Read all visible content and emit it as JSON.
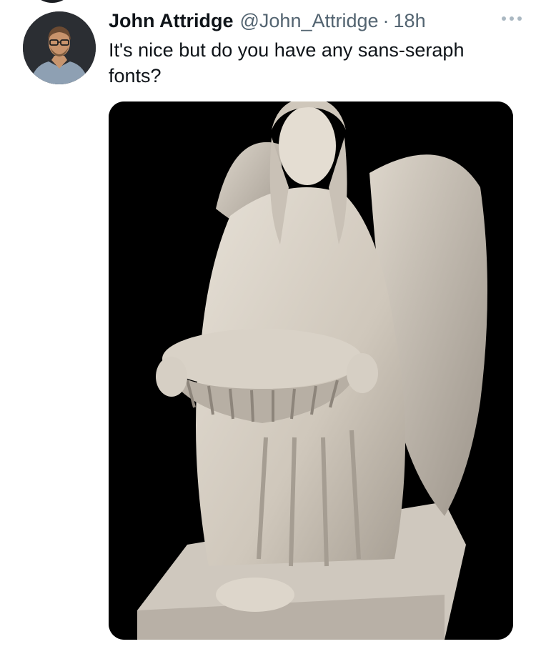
{
  "tweet": {
    "author_name": "John Attridge",
    "handle": "@John_Attridge",
    "separator": "·",
    "timestamp": "18h",
    "text_lines": [
      "It's nice but do you have any sans-seraph",
      "fonts?"
    ]
  },
  "icons": {
    "more": "more-horizontal-icon",
    "avatar": "avatar-photo",
    "media": "angel-statue-photo"
  },
  "colors": {
    "text_primary": "#0f1419",
    "text_secondary": "#536471",
    "media_background": "#000000"
  }
}
